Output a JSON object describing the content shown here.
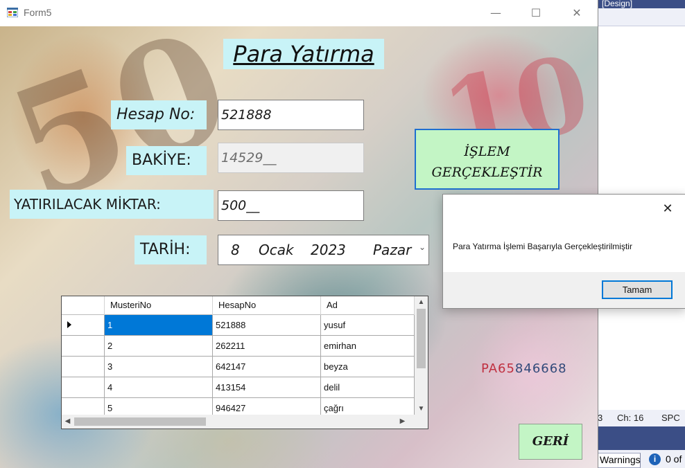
{
  "window": {
    "title": "Form5",
    "controls": {
      "minimize": "—",
      "maximize": "☐",
      "close": "✕"
    }
  },
  "ide_background": {
    "tab_title": "[Design]",
    "status": {
      "line_tail": "3",
      "column": "Ch: 16",
      "mode": "SPC"
    },
    "warnings_label": "Warnings",
    "messages_label": "0 of"
  },
  "form": {
    "page_title": "Para Yatırma",
    "labels": {
      "hesap_no": "Hesap No:",
      "bakiye": "BAKİYE:",
      "yatirilacak_miktar": "YATIRILACAK MİKTAR:",
      "tarih": "TARİH:"
    },
    "inputs": {
      "hesap_no": "521888",
      "bakiye": "14529__",
      "yatirilacak_miktar": "500__"
    },
    "date": {
      "day": "8",
      "month": "Ocak",
      "year": "2023",
      "weekday": "Pazar"
    },
    "buttons": {
      "islem_line1": "İŞLEM",
      "islem_line2": "GERÇEKLEŞTİR",
      "geri": "GERİ"
    },
    "background_text": {
      "fifty": "50",
      "ten": "10",
      "serial_prefix": "PA65",
      "serial_number": "846668"
    }
  },
  "grid": {
    "columns": [
      "MusteriNo",
      "HesapNo",
      "Ad"
    ],
    "rows": [
      [
        "1",
        "521888",
        "yusuf"
      ],
      [
        "2",
        "262211",
        "emirhan"
      ],
      [
        "3",
        "642147",
        "beyza"
      ],
      [
        "4",
        "413154",
        "delil"
      ],
      [
        "5",
        "946427",
        "çağrı"
      ]
    ],
    "selected_row": 0
  },
  "message_box": {
    "text": "Para Yatırma İşlemi Başarıyla Gerçekleştirilmiştir",
    "ok_label": "Tamam",
    "close_glyph": "✕"
  },
  "colors": {
    "label_bg": "#c8f3f7",
    "button_bg": "#c3f5c5",
    "button_focus_border": "#1e6fd0",
    "selection": "#0078d7",
    "ide_accent": "#3b4e86"
  }
}
